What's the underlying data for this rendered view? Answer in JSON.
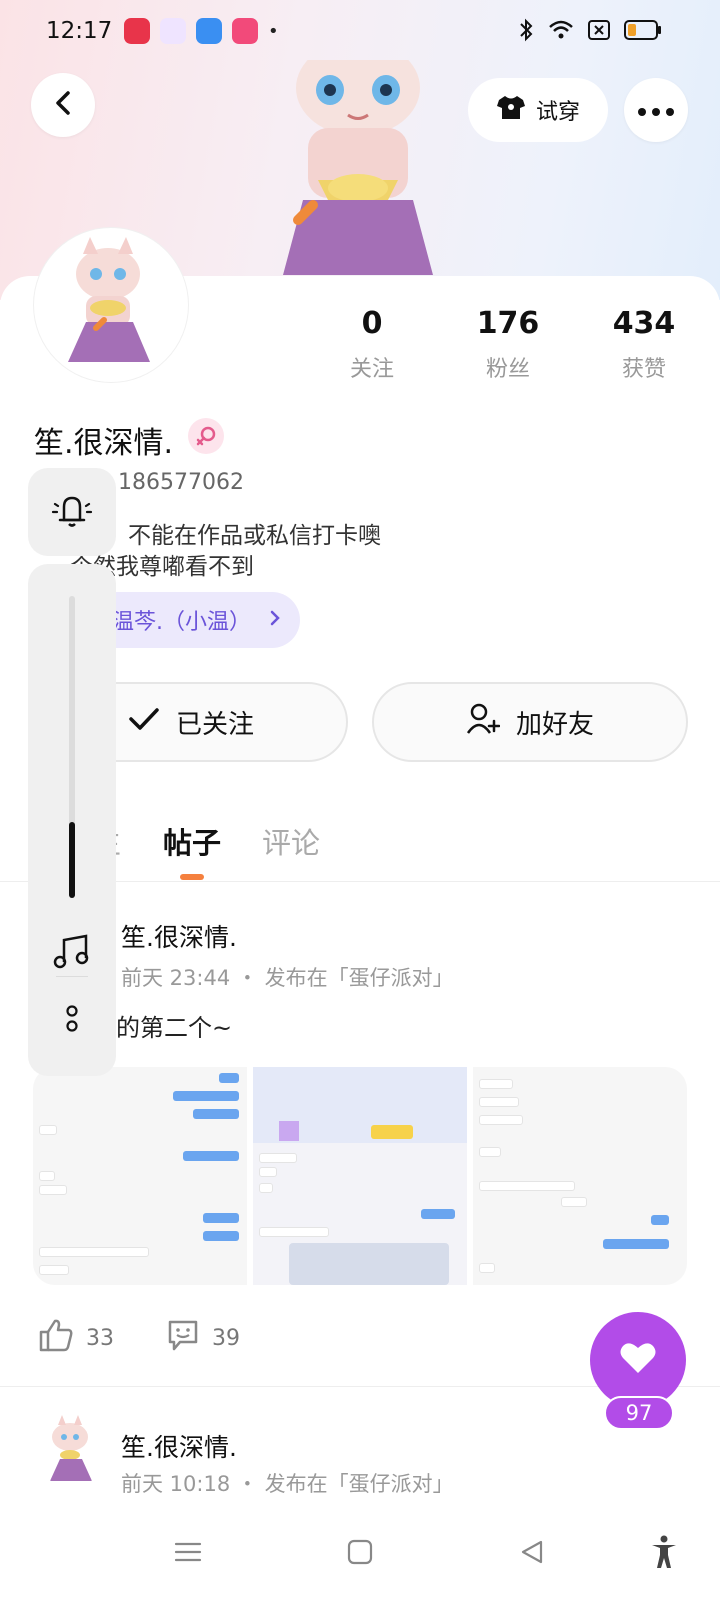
{
  "status_bar": {
    "time": "12:17",
    "app_icons": [
      "youtube-music-icon",
      "app-icon",
      "blue-app-icon",
      "video-app-icon"
    ],
    "notification_dot": "•"
  },
  "header": {
    "back_icon": "back-arrow-icon",
    "tryon_label": "试穿",
    "more_icon": "more-icon"
  },
  "profile": {
    "stats": [
      {
        "value": "0",
        "label": "关注"
      },
      {
        "value": "176",
        "label": "粉丝"
      },
      {
        "value": "434",
        "label": "获赞"
      }
    ],
    "name": "笙.很深情.",
    "gender": "female",
    "id_fragment": "186577062",
    "bio_line_1": "不能在作品或私信打卡噢",
    "bio_line_2": "个然我尊嘟看不到",
    "guild_chip": "温芩.（小温）",
    "follow_label": "已关注",
    "add_friend_label": "加好友"
  },
  "tabs": [
    {
      "label": "生",
      "active": false
    },
    {
      "label": "帖子",
      "active": true
    },
    {
      "label": "评论",
      "active": false
    }
  ],
  "posts": [
    {
      "author": "笙.很深情.",
      "time": "前天 23:44",
      "dot": "・",
      "published_in": "发布在「蛋仔派对」",
      "text": "的第二个~",
      "likes": "33",
      "comments": "39"
    },
    {
      "author": "笙.很深情.",
      "time": "前天 10:18",
      "dot": "・",
      "published_in": "发布在「蛋仔派对」"
    }
  ],
  "floating_like": {
    "count": "97",
    "color": "#b24ce8"
  },
  "side_panel": {
    "volume_level": 0.25
  },
  "colors": {
    "accent_orange": "#f5803e",
    "guild_purple": "#6b54d9",
    "like_purple": "#b24ce8"
  }
}
